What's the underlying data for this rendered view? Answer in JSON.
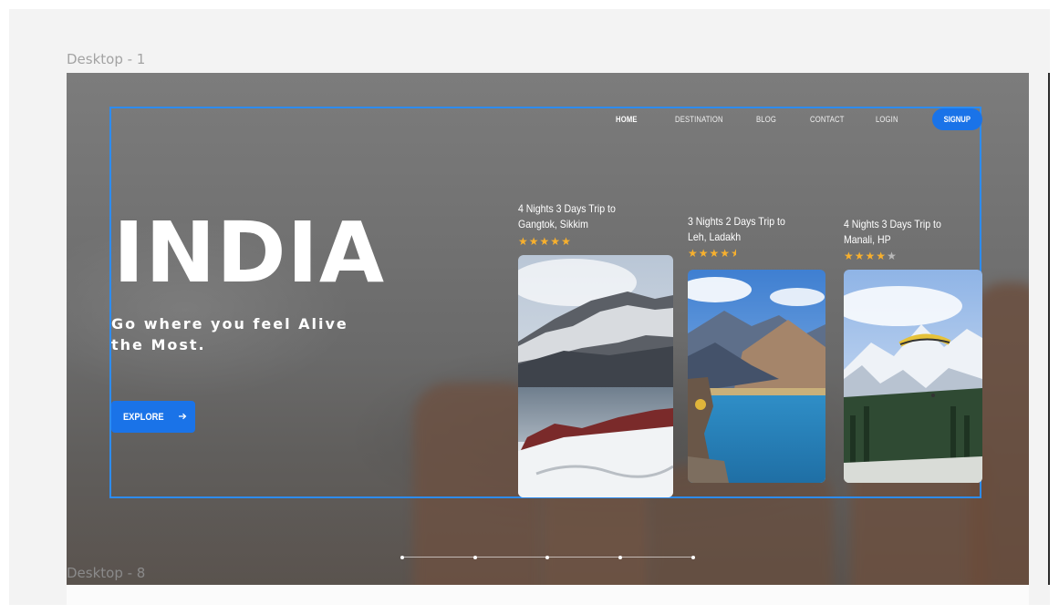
{
  "canvas": {
    "frame_top_label": "Desktop - 1",
    "frame_bottom_label": "Desktop - 8"
  },
  "nav": {
    "items": [
      "HOME",
      "DESTINATION",
      "BLOG",
      "CONTACT",
      "LOGIN"
    ],
    "signup_label": "SIGNUP",
    "active": "HOME"
  },
  "hero": {
    "title": "INDIA",
    "tagline": "Go where you feel Alive the Most.",
    "cta_label": "EXPLORE",
    "cta_icon": "arrow-right-icon"
  },
  "trips": [
    {
      "title_line1": "4 Nights 3 Days Trip to",
      "title_line2": "Gangtok, Sikkim",
      "rating": 5,
      "image": "snowy-mountain-lake"
    },
    {
      "title_line1": "3 Nights 2 Days Trip to",
      "title_line2": "Leh, Ladakh",
      "rating": 4.5,
      "image": "blue-mountain-lake"
    },
    {
      "title_line1": "4 Nights 3 Days Trip to",
      "title_line2": "Manali, HP",
      "rating": 4,
      "image": "paraglider-snow-peaks"
    }
  ],
  "slider": {
    "dot_count": 5
  },
  "colors": {
    "accent": "#1a73e8",
    "star": "#f7b02e",
    "selection": "#2d8cf0"
  }
}
